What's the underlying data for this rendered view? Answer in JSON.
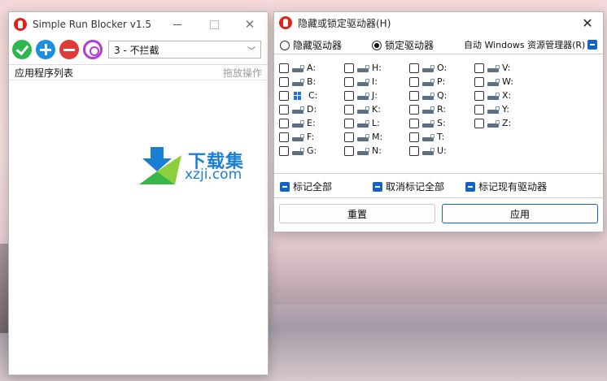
{
  "colors": {
    "accent": "#1463c4",
    "watermark": "#1b7fd1",
    "app_icon": "#e2231a"
  },
  "main_window": {
    "title": "Simple Run Blocker v1.5",
    "toolbar": {
      "icons": [
        "check-icon",
        "plus-icon",
        "minus-icon",
        "gear-icon"
      ],
      "mode_select_value": "3 - 不拦截"
    },
    "list": {
      "header": "应用程序列表",
      "action": "拖放操作"
    },
    "watermark": {
      "cn": "下载集",
      "en": "xzji.com"
    }
  },
  "drive_dialog": {
    "title": "隐藏或锁定驱动器(H)",
    "modes": [
      {
        "label": "隐藏驱动器",
        "selected": false
      },
      {
        "label": "锁定驱动器",
        "selected": true
      }
    ],
    "restart_label": "自动 Windows 资源管理器(R)",
    "drive_columns": [
      [
        "A:",
        "B:",
        "C:",
        "D:",
        "E:",
        "F:",
        "G:"
      ],
      [
        "H:",
        "I:",
        "J:",
        "K:",
        "L:",
        "M:",
        "N:"
      ],
      [
        "O:",
        "P:",
        "Q:",
        "R:",
        "S:",
        "T:",
        "U:"
      ],
      [
        "V:",
        "W:",
        "X:",
        "Y:",
        "Z:"
      ]
    ],
    "system_drive": "C:",
    "mark_all": "标记全部",
    "unmark_all": "取消标记全部",
    "mark_existing": "标记现有驱动器",
    "reset_label": "重置",
    "apply_label": "应用"
  }
}
